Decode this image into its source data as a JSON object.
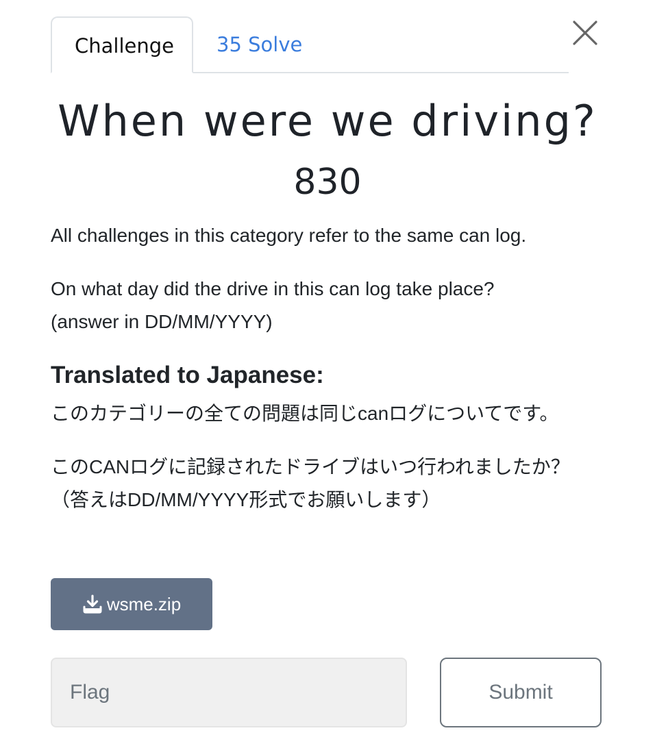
{
  "tabs": [
    {
      "label": "Challenge",
      "active": true
    },
    {
      "label": "35 Solve",
      "active": false
    }
  ],
  "close_icon": "close-icon",
  "challenge": {
    "title": "When were we driving?",
    "points": "830",
    "description": {
      "paragraph_1": "All challenges in this category refer to the same can log.",
      "paragraph_2_line_1": "On what day did the drive in this can log take place?",
      "paragraph_2_line_2": "(answer in DD/MM/YYYY)",
      "heading": "Translated to Japanese:",
      "paragraph_3": "このカテゴリーの全ての問題は同じcanログについてです。",
      "paragraph_4": "このCANログに記録されたドライブはいつ行われましたか？（答えはDD/MM/YYYY形式でお願いします）"
    }
  },
  "file": {
    "name": "wsme.zip",
    "icon": "download-icon"
  },
  "flag_form": {
    "placeholder": "Flag",
    "value": "",
    "submit_label": "Submit"
  },
  "colors": {
    "link": "#3b7ddd",
    "file_button": "#627187",
    "submit_border": "#6c757d"
  }
}
